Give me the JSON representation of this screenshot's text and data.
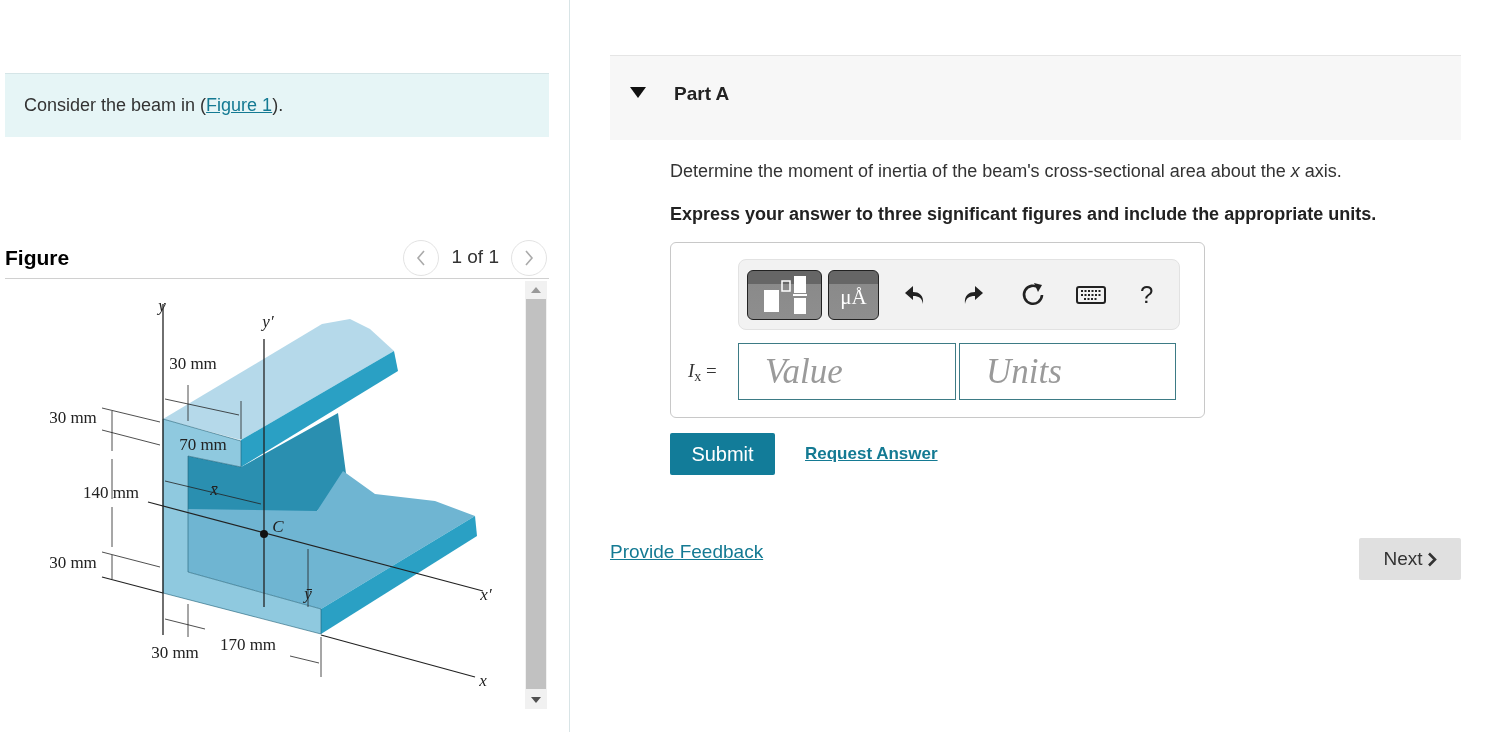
{
  "intro": {
    "before": "Consider the beam in (",
    "link": "Figure 1",
    "after": ")."
  },
  "figure": {
    "title": "Figure",
    "pager": "1 of 1",
    "labels": [
      "y",
      "y′",
      "30 mm",
      "70 mm",
      "30 mm",
      "140 mm",
      "30 mm",
      "x̄",
      "C",
      "ȳ",
      "x′",
      "30 mm",
      "170 mm",
      "x"
    ]
  },
  "part": {
    "title": "Part A",
    "expanded": true,
    "question": "Determine the moment of inertia of the beam's cross-sectional area about the *x* axis.",
    "instruction": "Express your answer to three significant figures and include the appropriate units.",
    "units_button": "μÅ",
    "help": "?",
    "answer_label": "*I*$_{x}$ =",
    "value_placeholder": "Value",
    "units_placeholder": "Units",
    "submit": "Submit",
    "request": "Request Answer"
  },
  "feedback": "Provide Feedback",
  "next": "Next"
}
